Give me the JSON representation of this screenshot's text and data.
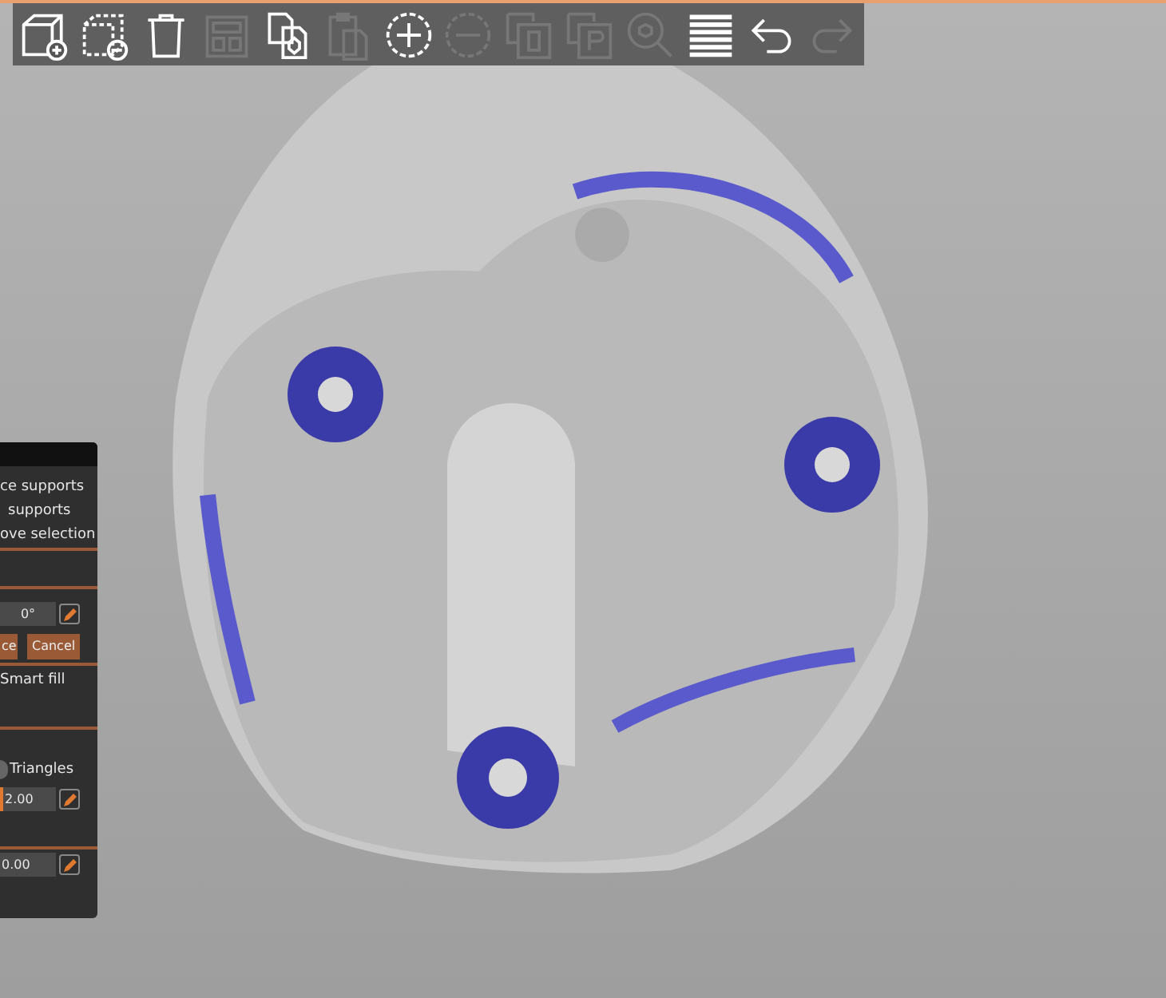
{
  "toolbar": {
    "buttons": [
      {
        "kind": "add",
        "enabled": true
      },
      {
        "kind": "remove",
        "enabled": true
      },
      {
        "kind": "delete",
        "enabled": true
      },
      {
        "kind": "arrange",
        "enabled": false
      },
      {
        "kind": "copy",
        "enabled": true
      },
      {
        "kind": "paste",
        "enabled": false
      },
      {
        "kind": "plus",
        "enabled": true
      },
      {
        "kind": "minus",
        "enabled": false
      },
      {
        "kind": "splitobjects",
        "enabled": false
      },
      {
        "kind": "splitparts",
        "enabled": false
      },
      {
        "kind": "search",
        "enabled": false
      },
      {
        "kind": "layers",
        "enabled": true
      },
      {
        "kind": "undo",
        "enabled": true
      },
      {
        "kind": "redo",
        "enabled": false
      }
    ]
  },
  "panel": {
    "actions": [
      "ce supports",
      "supports",
      "ove selection"
    ],
    "angle": {
      "value": "0°"
    },
    "buttons": [
      "ce",
      "Cancel"
    ],
    "smart_fill": {
      "label": "Smart fill"
    },
    "mode": {
      "label": "Triangles",
      "selected": false
    },
    "size": {
      "value": "2.00",
      "level": 0.05
    },
    "gap": {
      "value": "0.00"
    }
  }
}
